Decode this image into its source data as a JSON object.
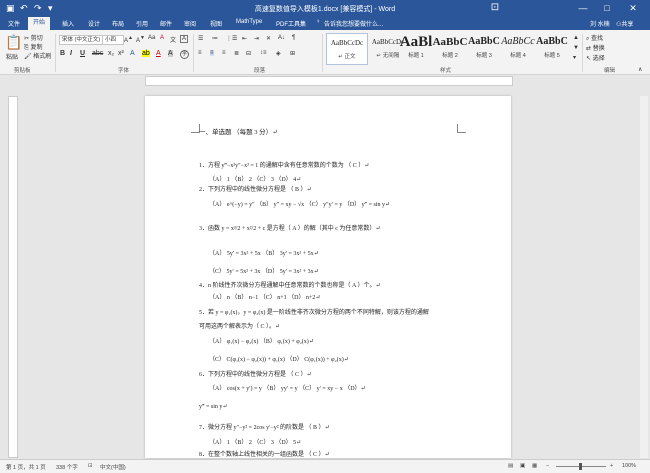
{
  "window": {
    "title": "高速复数值导入模板1.docx [兼容模式] - Word",
    "user": "刘 水楠",
    "share": "共享"
  },
  "tabs": [
    "文件",
    "开始",
    "插入",
    "设计",
    "布局",
    "引用",
    "邮件",
    "审阅",
    "视图",
    "MathType",
    "PDF工具集"
  ],
  "tell_me": "告诉我您想要做什么...",
  "ribbon": {
    "paste": "粘贴",
    "cut": "剪切",
    "copy": "复制",
    "format_painter": "格式刷",
    "clipboard": "剪贴板",
    "font_name": "宋体 (中文正文)",
    "font_size": "小四",
    "font": "字体",
    "paragraph": "段落",
    "styles_group": "样式",
    "editing_group": "编辑",
    "find": "查找",
    "replace": "替换",
    "select": "选择",
    "styles": [
      {
        "sample": "AaBbCcDc",
        "name": "↵ 正文"
      },
      {
        "sample": "AaBbCcDc",
        "name": "↵ 无间隔"
      },
      {
        "sample": "AaBl",
        "name": "标题 1"
      },
      {
        "sample": "AaBbC",
        "name": "标题 2"
      },
      {
        "sample": "AaBbC",
        "name": "标题 3"
      },
      {
        "sample": "AaBbCc",
        "name": "标题 4"
      },
      {
        "sample": "AaBbC",
        "name": "标题 5"
      }
    ]
  },
  "document": {
    "lines": [
      "一、单选题 （每题 3 分）↵",
      "1．方程 y‴−x²y″−x³ = 1 的通解中含有任意常数的个数为          （  C  ）↵",
      "（A） 1                    （B） 2                    （C） 3                    （D） 4↵",
      "2．下列方程中的线性微分方程是                                    （  B  ）↵",
      "（A）  e^(−y) = y″      （B）  y″ = xy − √x      （C）  y″y′ = y      （D）  y‴ = sin y↵",
      "3．函数 y = x³/2 + x²/2 + c 是方程（   A   ）的解（其中 c 为任意常数）↵",
      "（A）  5y′ = 3x² + 5x                         （B）  3y′ = 3x² + 5x↵",
      "（C）  5y′ = 5x² + 3x                         （D）  5y′ = 3x² + 3x↵",
      "4．n 阶线性齐次微分方程通解中任意常数的个数也称是（   A   ）个。↵",
      "（A） n              （B） n−1              （C） n+1              （D） n+2↵",
      "5．若 y = φ₁(x)，y = φ₂(x) 是一阶线性非齐次微分方程的两个不同特解，则该方程的通解",
      "可用这两个解表示为（  C  ）。↵",
      "（A）  φ₁(x) − φ₂(x)                         （B）  φ₁(x) + φ₂(x)↵",
      "（C）  C(φ₁(x) − φ₂(x)) + φ₁(x)             （D）  C(φ₁(x)) + φ₂(x)↵",
      "6．下列方程中的线性微分方程是          （  C  ）↵",
      "（A）  cos(x + y′) = y       （B）  yy′ = y   （C）  y′ = xy − x            （D）↵",
      "y‴ = sin y↵",
      "7．微分方程 y″−y² = 2cos y′−y² 的阶数是                            （  B  ）↵",
      "（A）  1            （B）  2            （C）  3            （D）  5↵",
      "8．在整个数轴上线性相关的一组函数是                                （  C  ）↵"
    ]
  },
  "status": {
    "page": "第 1 页，共 1 页",
    "words": "338 个字",
    "lang": "中文(中国)",
    "zoom": "100%"
  }
}
